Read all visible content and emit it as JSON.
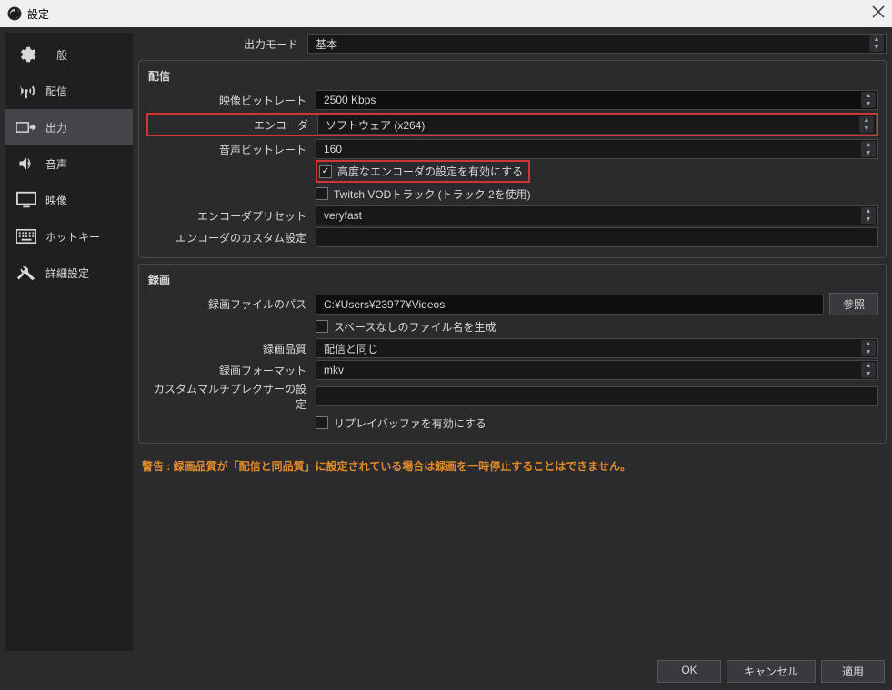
{
  "window": {
    "title": "設定"
  },
  "sidebar": {
    "items": [
      {
        "label": "一般"
      },
      {
        "label": "配信"
      },
      {
        "label": "出力"
      },
      {
        "label": "音声"
      },
      {
        "label": "映像"
      },
      {
        "label": "ホットキー"
      },
      {
        "label": "詳細設定"
      }
    ]
  },
  "output_mode": {
    "label": "出力モード",
    "value": "基本"
  },
  "streaming": {
    "section": "配信",
    "video_bitrate_label": "映像ビットレート",
    "video_bitrate": "2500 Kbps",
    "encoder_label": "エンコーダ",
    "encoder": "ソフトウェア (x264)",
    "audio_bitrate_label": "音声ビットレート",
    "audio_bitrate": "160",
    "adv_encoder_label": "高度なエンコーダの設定を有効にする",
    "twitch_vod_label": "Twitch VODトラック (トラック 2を使用)",
    "encoder_preset_label": "エンコーダプリセット",
    "encoder_preset": "veryfast",
    "encoder_custom_label": "エンコーダのカスタム設定",
    "encoder_custom": ""
  },
  "recording": {
    "section": "録画",
    "path_label": "録画ファイルのパス",
    "path": "C:¥Users¥23977¥Videos",
    "browse": "参照",
    "nospace_label": "スペースなしのファイル名を生成",
    "quality_label": "録画品質",
    "quality": "配信と同じ",
    "format_label": "録画フォーマット",
    "format": "mkv",
    "muxer_label": "カスタムマルチプレクサーの設定",
    "muxer": "",
    "replay_label": "リプレイバッファを有効にする"
  },
  "warning": "警告 : 録画品質が「配信と同品質」に設定されている場合は録画を一時停止することはできません。",
  "buttons": {
    "ok": "OK",
    "cancel": "キャンセル",
    "apply": "適用"
  }
}
